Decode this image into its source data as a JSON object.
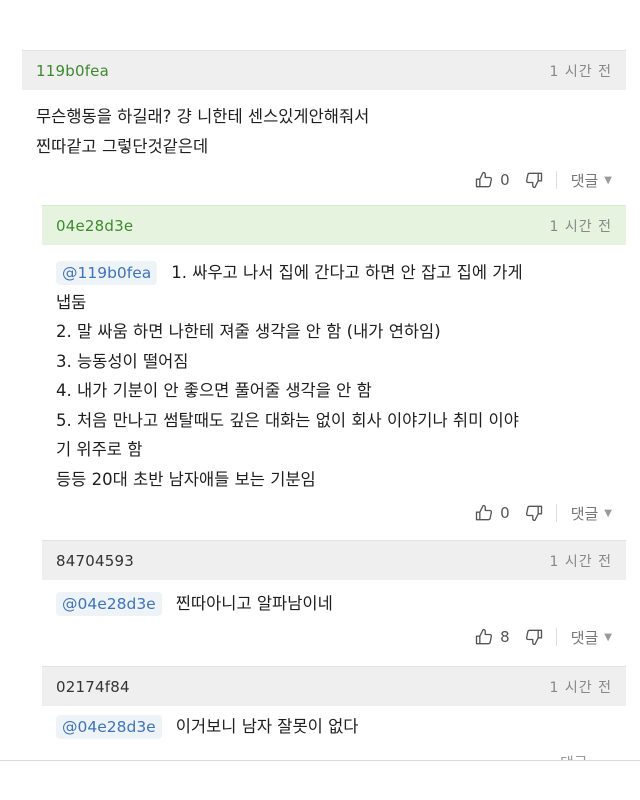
{
  "comments": [
    {
      "user": "119b0fea",
      "time": "1 시간 전",
      "lines": [
        "무슨행동을 하길래? 걍 니한테 센스있게안해줘서",
        "찐따같고 그렇단것같은데"
      ],
      "likes": "0",
      "reply_label": "댓글"
    },
    {
      "user": "04e28d3e",
      "time": "1 시간 전",
      "mention": "@119b0fea",
      "first_line": "1. 싸우고 나서 집에 간다고 하면 안 잡고 집에 가게",
      "lines": [
        "냅둠",
        "2. 말 싸움 하면 나한테 져줄 생각을 안 함 (내가 연하임)",
        "3. 능동성이 떨어짐",
        "4. 내가 기분이 안 좋으면 풀어줄 생각을 안 함",
        "5. 처음 만나고 썸탈때도 깊은 대화는 없이 회사 이야기나 취미 이야",
        "기 위주로 함",
        "등등 20대 초반 남자애들 보는 기분임"
      ],
      "likes": "0",
      "reply_label": "댓글"
    },
    {
      "user": "84704593",
      "time": "1 시간 전",
      "mention": "@04e28d3e",
      "first_line": "찐따아니고 알파남이네",
      "likes": "8",
      "reply_label": "댓글"
    },
    {
      "user": "02174f84",
      "time": "1 시간 전",
      "mention": "@04e28d3e",
      "first_line": "이거보니 남자 잘못이 없다",
      "reply_label": "댓글"
    }
  ],
  "colors": {
    "header_gray": "#efefef",
    "header_green": "#e6f4df",
    "user_green": "#3d8a2e",
    "mention_blue": "#3f73b8"
  },
  "icons": [
    "thumbs-up-icon",
    "thumbs-down-icon",
    "chevron-down-icon"
  ]
}
